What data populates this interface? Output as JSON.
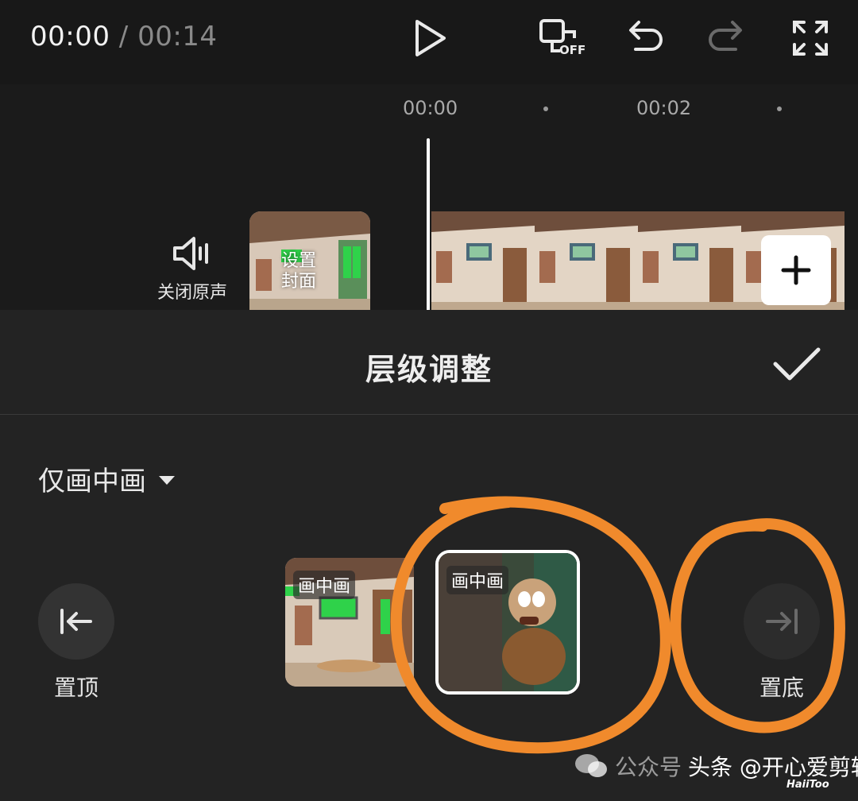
{
  "player": {
    "current_time": "00:00",
    "separator": "/",
    "total_time": "00:14"
  },
  "toolbar": {
    "play_icon": "play-icon",
    "original_sound_toggle": {
      "icon": "screen-off-icon",
      "badge": "OFF"
    },
    "undo_icon": "undo-icon",
    "redo_icon": "redo-icon",
    "fullscreen_icon": "fullscreen-icon"
  },
  "timeline": {
    "ticks": [
      "00:00",
      "00:02"
    ],
    "mute_label": "关闭原声",
    "cover_label_line1": "设置",
    "cover_label_line2": "封面",
    "add_icon": "plus-icon"
  },
  "panel": {
    "title": "层级调整",
    "confirm_icon": "checkmark-icon",
    "filter_label": "仅画中画",
    "move_top_label": "置顶",
    "move_bottom_label": "置底",
    "layers": [
      {
        "tag": "画中画",
        "selected": false
      },
      {
        "tag": "画中画",
        "selected": true
      }
    ]
  },
  "watermark": {
    "text_faint": "公众号",
    "text": "头条 @开心爱剪辑",
    "sub": "HaiiToo"
  },
  "colors": {
    "annotation": "#f08a2c",
    "accent_green": "#2fd24a",
    "background": "#232323"
  }
}
